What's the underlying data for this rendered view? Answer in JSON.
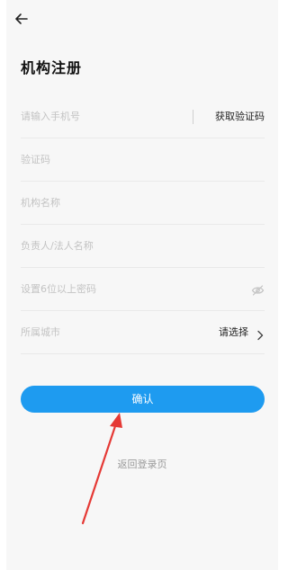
{
  "header": {
    "back_icon": "arrow-left-icon"
  },
  "page": {
    "title": "机构注册"
  },
  "form": {
    "phone": {
      "placeholder": "请输入手机号",
      "code_button": "获取验证码"
    },
    "code": {
      "placeholder": "验证码"
    },
    "org_name": {
      "placeholder": "机构名称"
    },
    "legal_person": {
      "placeholder": "负责人/法人名称"
    },
    "password": {
      "placeholder": "设置6位以上密码",
      "icon": "eye-hidden-icon"
    },
    "city": {
      "label": "所属城市",
      "value": "请选择",
      "icon": "chevron-right-icon"
    }
  },
  "actions": {
    "confirm_label": "确认",
    "back_to_login": "返回登录页"
  },
  "colors": {
    "accent": "#1e9bf0",
    "annotation": "#e53935",
    "background": "#f7f7f7"
  }
}
